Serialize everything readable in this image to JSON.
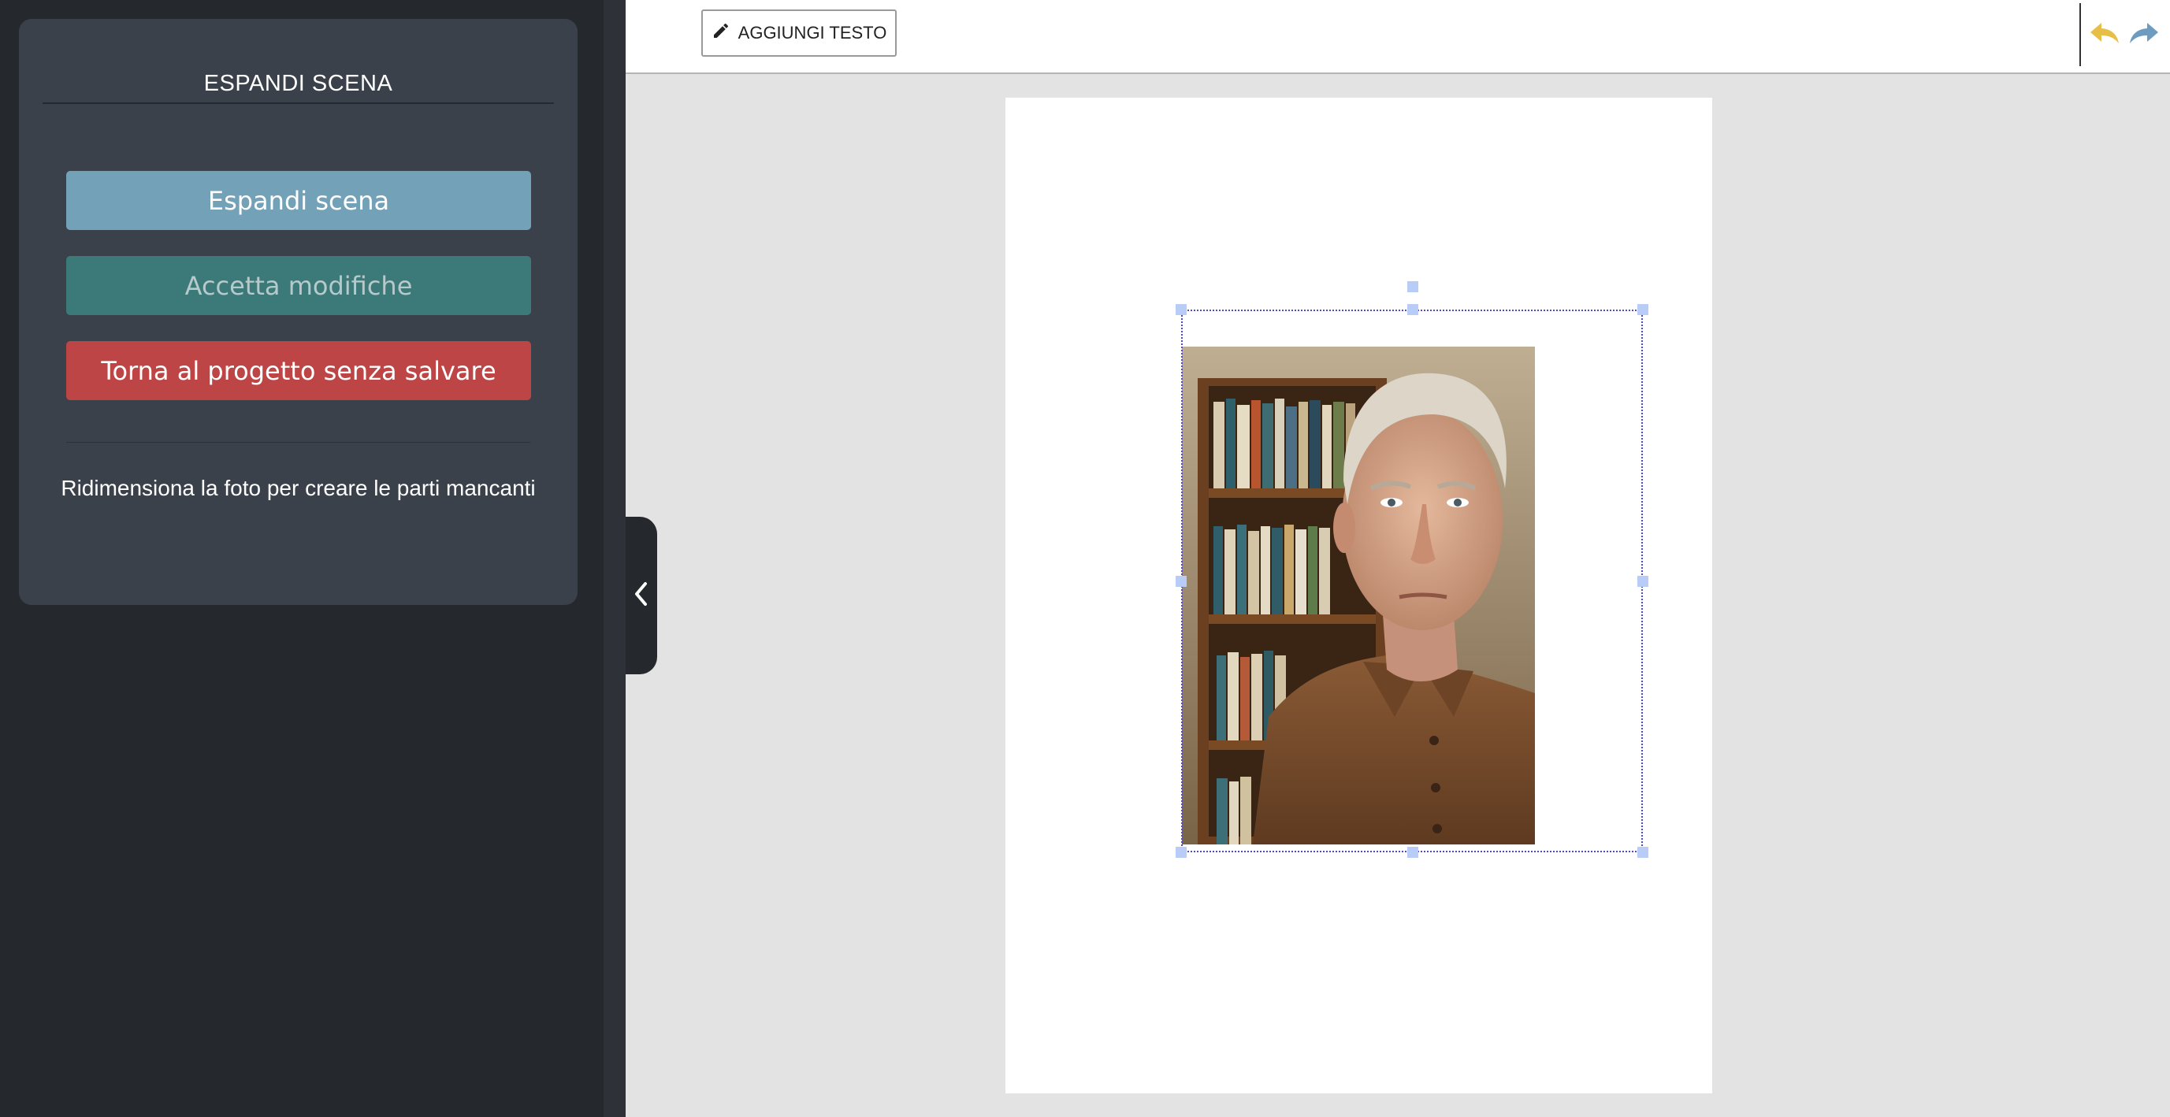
{
  "sidebar": {
    "title": "ESPANDI SCENA",
    "buttons": {
      "expand": "Espandi scena",
      "accept": "Accetta modifiche",
      "back": "Torna al progetto senza salvare"
    },
    "hint": "Ridimensiona la foto per creare le parti mancanti"
  },
  "toolbar": {
    "add_text": "AGGIUNGI TESTO",
    "icons": {
      "add_text": "pencil-icon",
      "undo": "undo-arrow-icon",
      "redo": "redo-arrow-icon"
    }
  },
  "colors": {
    "expand_button": "#73a1b8",
    "accept_button": "#3c7a7a",
    "back_button": "#be4545",
    "undo_icon": "#e8bf46",
    "redo_icon": "#6e9cc0",
    "selection_border": "#4a4ad6",
    "selection_handle": "#b9ccf7"
  },
  "canvas": {
    "photo": "portrait-photo: elderly man in brown shirt in front of bookshelf"
  }
}
